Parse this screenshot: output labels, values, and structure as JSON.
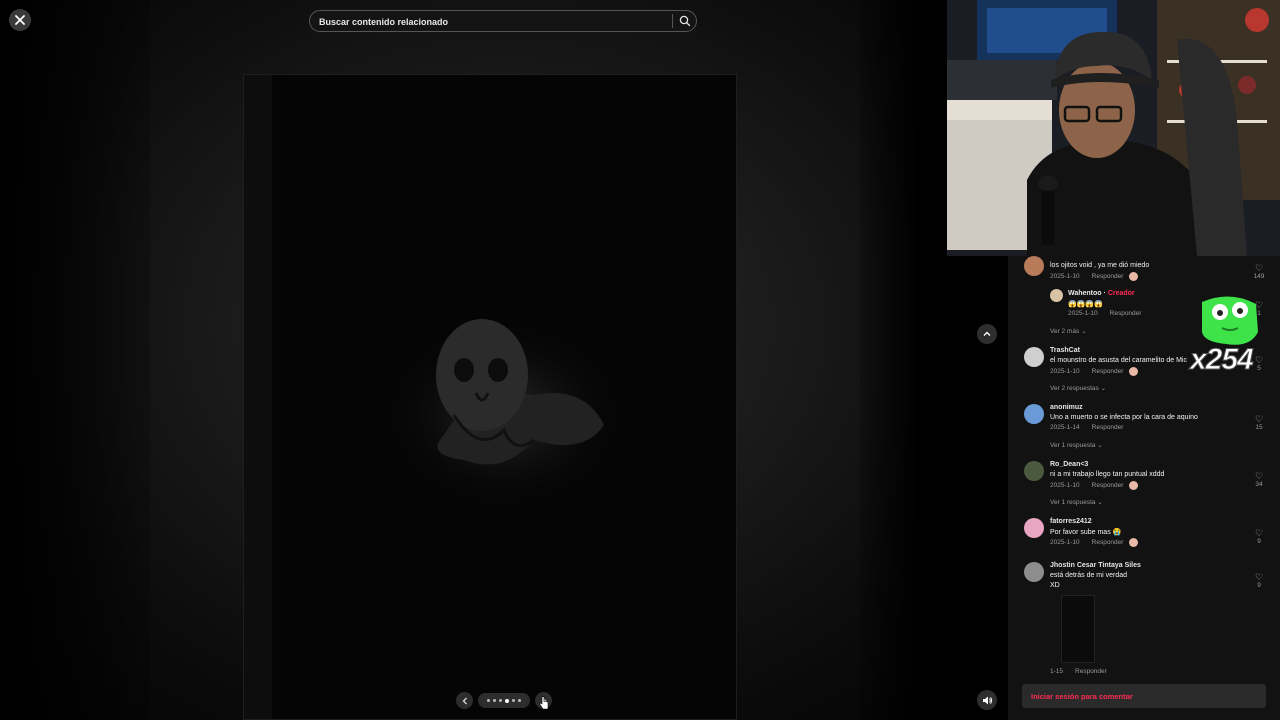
{
  "viewer": {
    "close_icon": "close-icon",
    "search": {
      "placeholder": "Buscar contenido relacionado",
      "icon": "search-icon"
    },
    "carousel": {
      "prev_icon": "chevron-left-icon",
      "next_icon": "chevron-right-icon",
      "dot_count": 6,
      "active_dot": 3
    },
    "scroll_up_icon": "chevron-up-icon",
    "volume_icon": "volume-icon"
  },
  "comments": {
    "items": [
      {
        "user": "...",
        "text": "los ojitos void , ya me dió miedo",
        "date": "2025-1-10",
        "reply_label": "Responder",
        "likes": "149",
        "avatar_color": "#b77b5a"
      },
      {
        "user": "Wahentoo",
        "creator_label": "Creador",
        "text": "😱😱😱😱",
        "date": "2025-1-10",
        "reply_label": "Responder",
        "likes": "1",
        "avatar_color": "#d8c4a4"
      },
      {
        "user": "TrashCat",
        "text": "el mounstro de asusta del caramelito de Mic",
        "date": "2025-1-10",
        "reply_label": "Responder",
        "likes": "5",
        "avatar_color": "#cfcfcf"
      },
      {
        "user": "anonimuz",
        "text": "Uno a muerto o se infecta por la cara de aquino",
        "date": "2025-1-14",
        "reply_label": "Responder",
        "likes": "15",
        "avatar_color": "#6a9bd8"
      },
      {
        "user": "Ro_Dean<3",
        "text": "ni a mi trabajo llego tan puntual xddd",
        "date": "2025-1-10",
        "reply_label": "Responder",
        "likes": "34",
        "avatar_color": "#4b5a3e"
      },
      {
        "user": "fatorres2412",
        "text": "Por favor sube mas 😭",
        "date": "2025-1-10",
        "reply_label": "Responder",
        "likes": "9",
        "avatar_color": "#e8a6c2"
      },
      {
        "user": "Jhostin Cesar Tintaya Siles",
        "text": "está detrás de mi verdad",
        "text2": "XD",
        "date": "1-15",
        "reply_label": "Responder",
        "likes": "9",
        "avatar_color": "#8d8d8d"
      }
    ],
    "view_more_1": "Ver 2 más",
    "view_more_2": "Ver 2 respuestas",
    "view_more_3": "Ver 1 respuesta",
    "view_more_4": "Ver 1 respuesta",
    "heart_icon": "heart-outline-icon",
    "login_label": "Iniciar sesión para comentar"
  },
  "overlay": {
    "emote_count": "x254",
    "emote_color": "#3ee34a"
  },
  "colors": {
    "accent": "#fe2c55",
    "panel_bg": "#121212"
  }
}
